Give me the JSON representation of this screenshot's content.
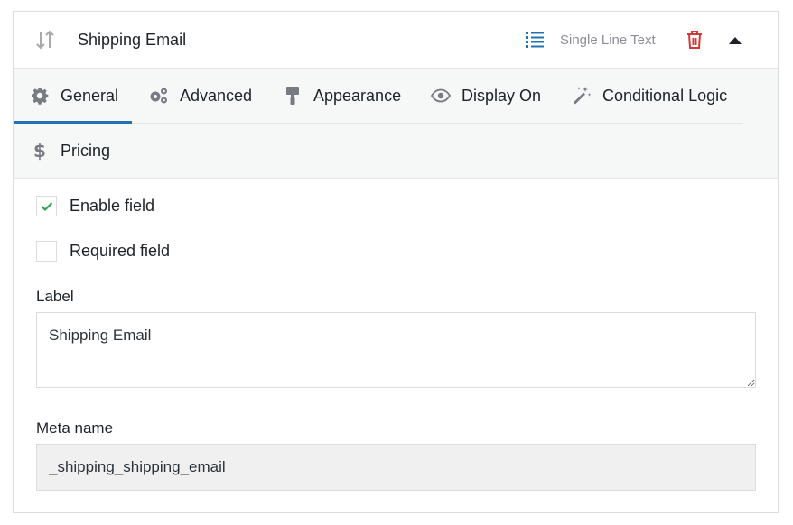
{
  "header": {
    "title": "Shipping Email",
    "field_type": "Single Line Text",
    "icons": {
      "drag": "sort-arrows-icon",
      "type": "list-icon",
      "delete": "trash-icon",
      "collapse": "caret-up-icon"
    },
    "colors": {
      "type_icon": "#2271b1",
      "delete_icon": "#d63638"
    }
  },
  "tabs": [
    {
      "label": "General",
      "icon": "gear-icon",
      "active": true
    },
    {
      "label": "Advanced",
      "icon": "gears-icon",
      "active": false
    },
    {
      "label": "Appearance",
      "icon": "paint-roller-icon",
      "active": false
    },
    {
      "label": "Display On",
      "icon": "eye-icon",
      "active": false
    },
    {
      "label": "Conditional Logic",
      "icon": "magic-wand-icon",
      "active": false
    },
    {
      "label": "Pricing",
      "icon": "dollar-icon",
      "active": false
    }
  ],
  "accent_color": "#2271b1",
  "general": {
    "enable_field": {
      "label": "Enable field",
      "checked": true
    },
    "required_field": {
      "label": "Required field",
      "checked": false
    },
    "label_field": {
      "label": "Label",
      "value": "Shipping Email"
    },
    "meta_name": {
      "label": "Meta name",
      "value": "_shipping_shipping_email"
    }
  }
}
